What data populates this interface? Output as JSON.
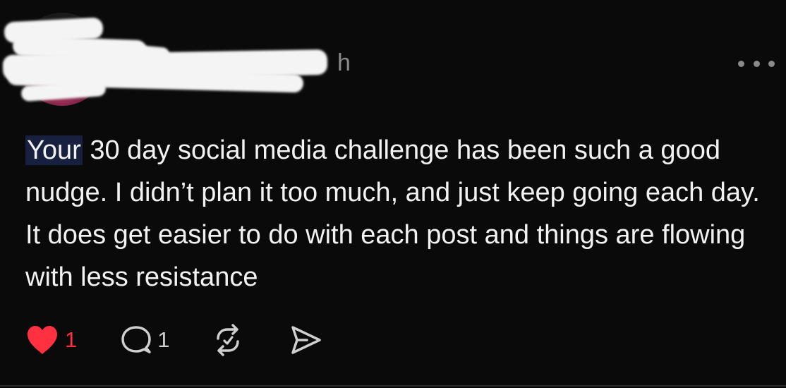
{
  "post": {
    "author_handle_visible_tail": "h",
    "body_highlight": "Your",
    "body_rest": " 30 day social media challenge has been such a good nudge. I didn’t plan it too much, and just keep going each day. It does get easier to do with each post and things are flowing with less resistance",
    "more_icon": "ellipsis-icon"
  },
  "actions": {
    "like": {
      "icon": "heart-icon",
      "count": "1",
      "liked": true,
      "color": "#ff3040"
    },
    "reply": {
      "icon": "comment-bubble-icon",
      "count": "1"
    },
    "repost": {
      "icon": "repost-icon"
    },
    "share": {
      "icon": "send-icon"
    }
  },
  "colors": {
    "background": "#0a0a0a",
    "text": "#f2f2f2",
    "muted": "#8a8a8a",
    "highlight": "#17213f",
    "like": "#ff3040"
  }
}
